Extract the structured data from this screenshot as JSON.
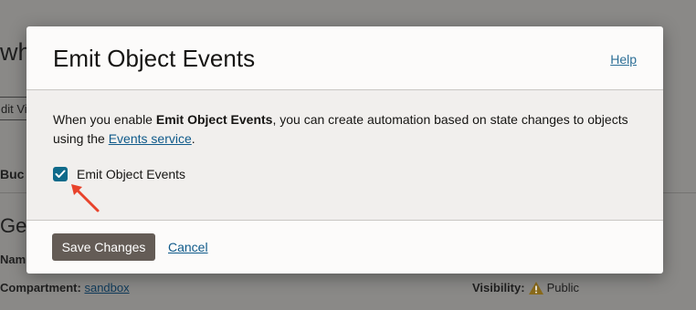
{
  "background": {
    "title_fragment": "wh",
    "edit_button_fragment": "dit Vi",
    "tab_fragment": "Buc",
    "section_fragment": "Ge",
    "name_label_fragment": "Nam",
    "compartment_label": "Compartment:",
    "compartment_value": "sandbox",
    "visibility_label": "Visibility:",
    "visibility_value": "Public"
  },
  "modal": {
    "title": "Emit Object Events",
    "help_label": "Help",
    "description": {
      "before": "When you enable ",
      "bold": "Emit Object Events",
      "middle": ", you can create automation based on state changes to objects using the ",
      "link": "Events service",
      "after": "."
    },
    "checkbox": {
      "label": "Emit Object Events",
      "checked": true
    },
    "save_label": "Save Changes",
    "cancel_label": "Cancel"
  },
  "colors": {
    "overlay": "#8a8987",
    "primary_button": "#645c56",
    "link": "#0f5a8a",
    "checkbox": "#0f6a8a",
    "annotation_arrow": "#e8432b",
    "warning": "#8a6a1a"
  }
}
